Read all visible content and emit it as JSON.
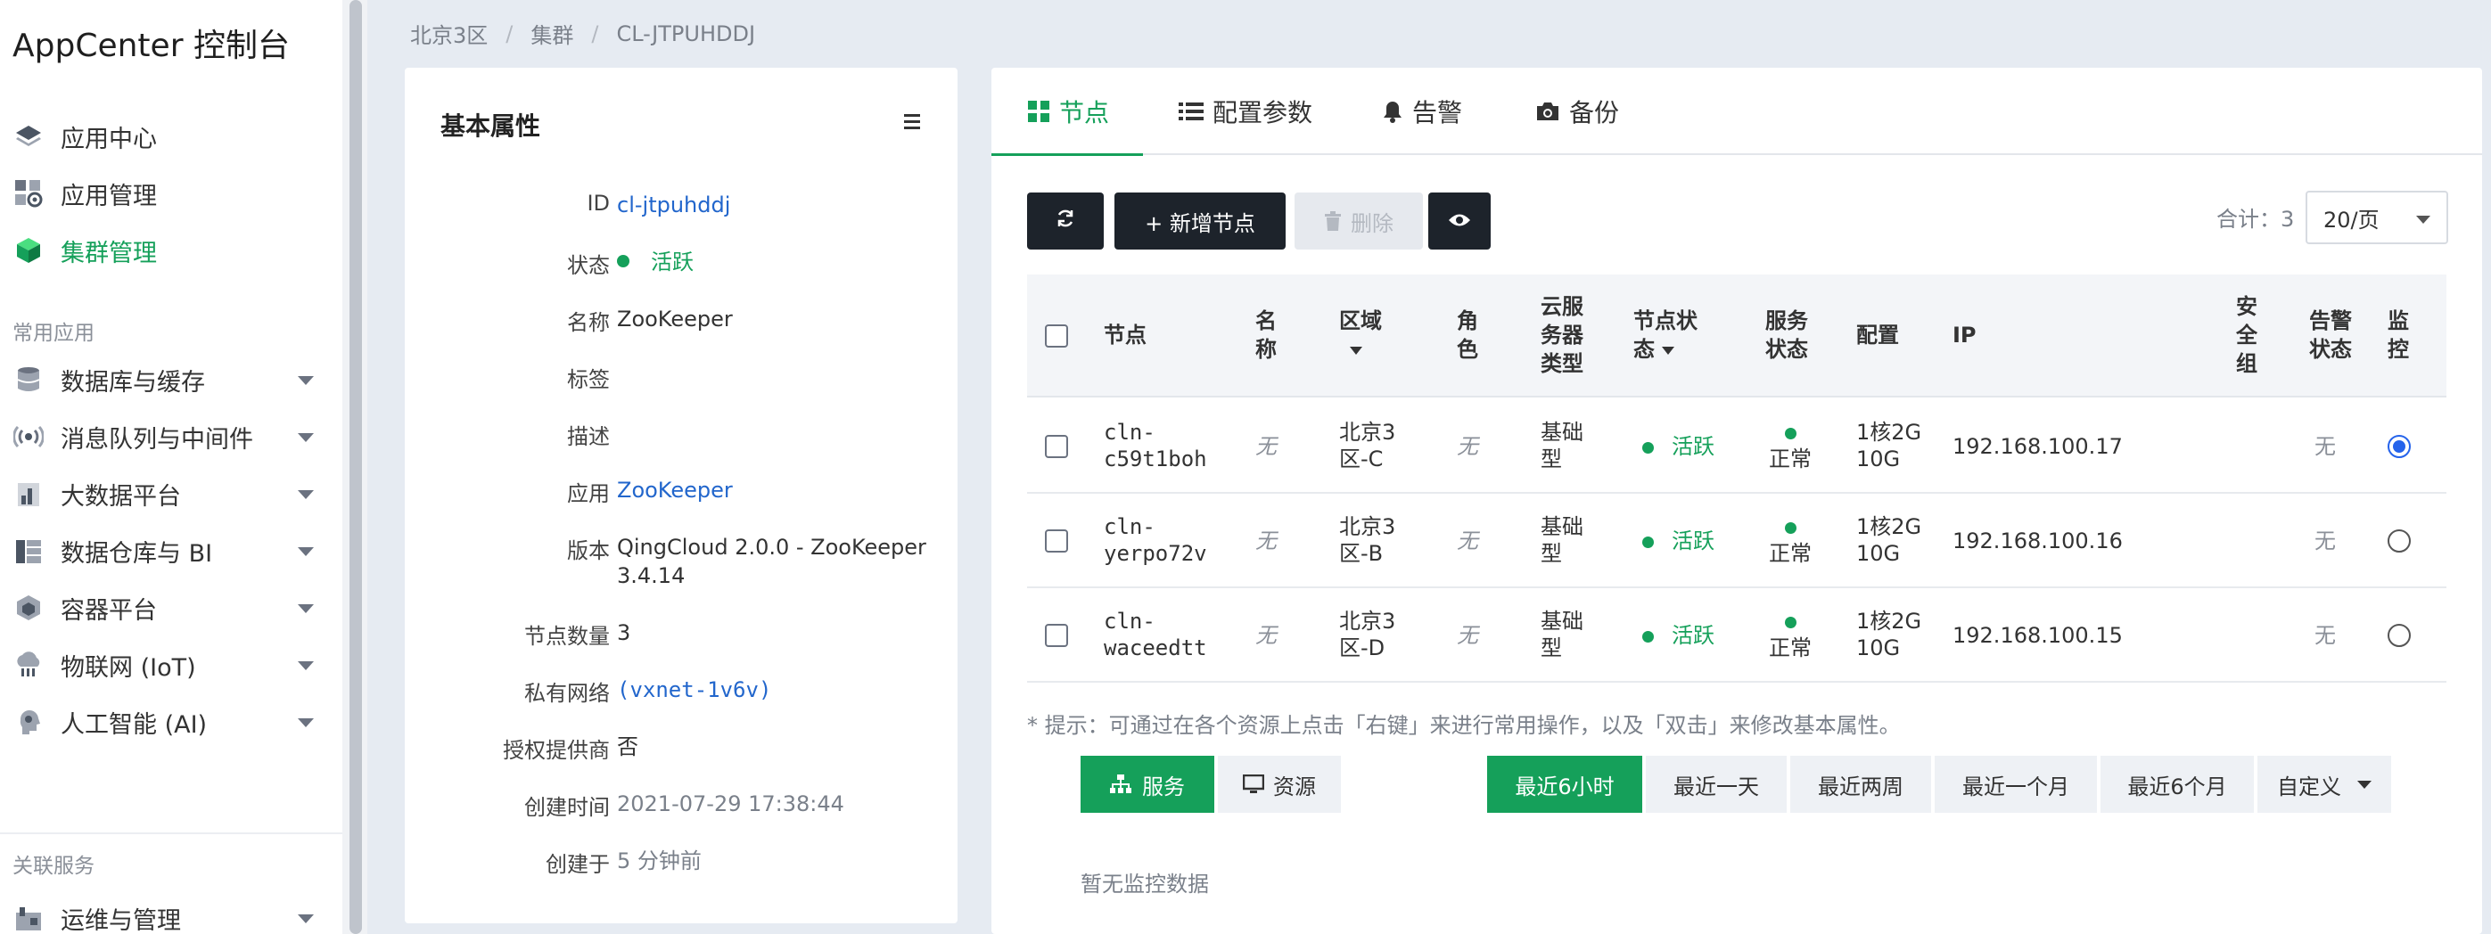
{
  "sidebar": {
    "title": "AppCenter 控制台",
    "main_items": [
      {
        "label": "应用中心",
        "icon": "layers-icon"
      },
      {
        "label": "应用管理",
        "icon": "app-grid-gear-icon"
      },
      {
        "label": "集群管理",
        "icon": "cube-icon"
      }
    ],
    "group_common": "常用应用",
    "common_items": [
      {
        "label": "数据库与缓存",
        "icon": "database-icon"
      },
      {
        "label": "消息队列与中间件",
        "icon": "broadcast-icon"
      },
      {
        "label": "大数据平台",
        "icon": "bar-chart-icon"
      },
      {
        "label": "数据仓库与 BI",
        "icon": "data-warehouse-icon"
      },
      {
        "label": "容器平台",
        "icon": "container-icon"
      },
      {
        "label": "物联网 (IoT)",
        "icon": "iot-cloud-icon"
      },
      {
        "label": "人工智能 (AI)",
        "icon": "ai-head-icon"
      }
    ],
    "group_related": "关联服务",
    "related_items": [
      {
        "label": "运维与管理",
        "icon": "ops-icon"
      }
    ],
    "active_color": "#15a05a"
  },
  "breadcrumb": [
    "北京3区",
    "集群",
    "CL-JTPUHDDJ"
  ],
  "props": {
    "title": "基本属性",
    "rows": [
      {
        "label": "ID",
        "value": "cl-jtpuhddj"
      },
      {
        "label": "状态",
        "value": "活跃"
      },
      {
        "label": "名称",
        "value": "ZooKeeper"
      },
      {
        "label": "标签",
        "value": ""
      },
      {
        "label": "描述",
        "value": ""
      },
      {
        "label": "应用",
        "value": "ZooKeeper"
      },
      {
        "label": "版本",
        "value": "QingCloud 2.0.0 - ZooKeeper 3.4.14"
      },
      {
        "label": "节点数量",
        "value": "3"
      },
      {
        "label": "私有网络",
        "value": "(vxnet-1v6v)"
      },
      {
        "label": "授权提供商",
        "value": "否"
      },
      {
        "label": "创建时间",
        "value": "2021-07-29 17:38:44"
      },
      {
        "label": "创建于",
        "value": "5 分钟前"
      }
    ]
  },
  "tabs": [
    {
      "label": "节点",
      "icon": "grid-icon"
    },
    {
      "label": "配置参数",
      "icon": "list-icon"
    },
    {
      "label": "告警",
      "icon": "bell-icon"
    },
    {
      "label": "备份",
      "icon": "camera-icon"
    }
  ],
  "toolbar": {
    "refresh_icon": "refresh-icon",
    "add_label": "+ 新增节点",
    "delete_label": "删除",
    "view_icon": "eye-icon",
    "total_label": "合计：3",
    "per_page": "20/页"
  },
  "table": {
    "headers": {
      "node": "节点",
      "name": "名称",
      "zone": "区域",
      "role": "角色",
      "type": "云服务器类型",
      "node_status": "节点状态",
      "service_status": "服务状态",
      "config": "配置",
      "ip": "IP",
      "security_group": "安全组",
      "alarm_status": "告警状态",
      "monitor": "监控"
    },
    "rows": [
      {
        "node": "cln-c59t1boh",
        "name": "无",
        "zone": "北京3区-C",
        "role": "无",
        "type": "基础型",
        "node_status": "活跃",
        "service_status": "正常",
        "config": "1核2G 10G",
        "ip": "192.168.100.17",
        "alarm": "无",
        "monitor_selected": true
      },
      {
        "node": "cln-yerpo72v",
        "name": "无",
        "zone": "北京3区-B",
        "role": "无",
        "type": "基础型",
        "node_status": "活跃",
        "service_status": "正常",
        "config": "1核2G 10G",
        "ip": "192.168.100.16",
        "alarm": "无",
        "monitor_selected": false
      },
      {
        "node": "cln-waceedtt",
        "name": "无",
        "zone": "北京3区-D",
        "role": "无",
        "type": "基础型",
        "node_status": "活跃",
        "service_status": "正常",
        "config": "1核2G 10G",
        "ip": "192.168.100.15",
        "alarm": "无",
        "monitor_selected": false
      }
    ]
  },
  "hint": "* 提示：可通过在各个资源上点击「右键」来进行常用操作，以及「双击」来修改基本属性。",
  "monitor": {
    "views": [
      {
        "label": "服务",
        "icon": "sitemap-icon"
      },
      {
        "label": "资源",
        "icon": "monitor-icon"
      }
    ],
    "ranges": [
      "最近6小时",
      "最近一天",
      "最近两周",
      "最近一个月",
      "最近6个月",
      "自定义"
    ],
    "active_range": "最近6小时",
    "no_data": "暂无监控数据"
  },
  "colors": {
    "accent": "#15a05a",
    "link": "#2266cc",
    "dark_button": "#1d232b",
    "radio_checked": "#2563eb"
  }
}
